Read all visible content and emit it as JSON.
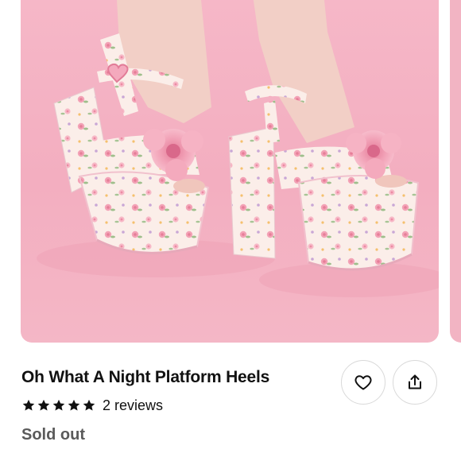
{
  "product": {
    "title": "Oh What A Night Platform Heels",
    "rating_stars": 5,
    "reviews_label": "2 reviews",
    "status": "Sold out",
    "image_alt": "Floral platform heels on pink background"
  },
  "actions": {
    "like": "heart-icon",
    "share": "share-icon"
  },
  "colors": {
    "background_pink": "#f6b8c8",
    "shoe_cream": "#fbeee9",
    "rose_pink": "#f4a3b8",
    "text": "#111111",
    "status_gray": "#5a5a5a"
  }
}
